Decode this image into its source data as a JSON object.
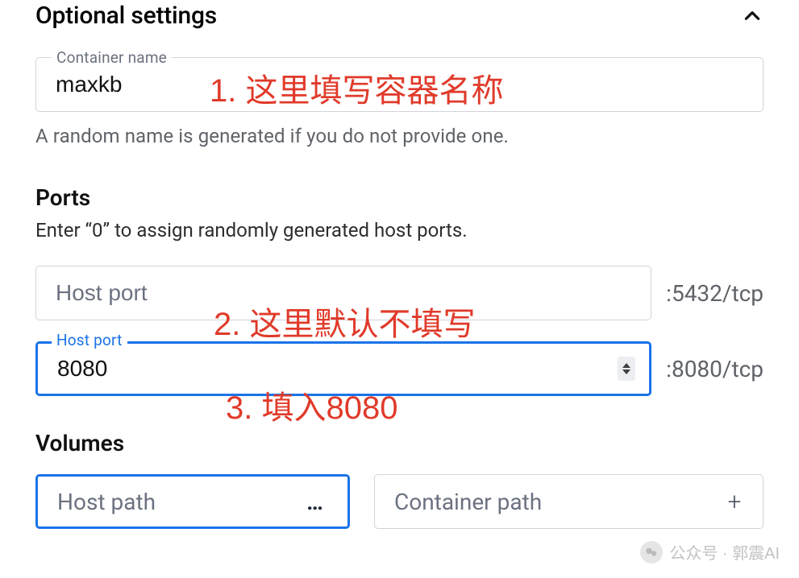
{
  "header": {
    "title": "Optional settings"
  },
  "container_name": {
    "label": "Container name",
    "value": "maxkb",
    "help": "A random name is generated if you do not provide one."
  },
  "ports": {
    "title": "Ports",
    "sub": "Enter “0” to assign randomly generated host ports.",
    "row1": {
      "placeholder": "Host port",
      "value": "",
      "suffix": ":5432/tcp"
    },
    "row2": {
      "label": "Host port",
      "value": "8080",
      "suffix": ":8080/tcp"
    }
  },
  "volumes": {
    "title": "Volumes",
    "host_placeholder": "Host path",
    "container_placeholder": "Container path",
    "ellipsis": "…",
    "plus": "+"
  },
  "annotations": {
    "a1": "1. 这里填写容器名称",
    "a2": "2. 这里默认不填写",
    "a3": "3. 填入8080"
  },
  "watermark": {
    "text": "公众号 · 郭震AI"
  }
}
